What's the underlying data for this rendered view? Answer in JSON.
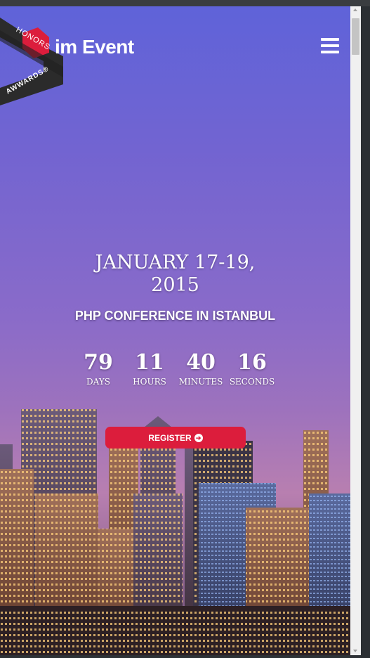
{
  "header": {
    "logo_text": "im Event",
    "menu_icon": "hamburger-menu-icon"
  },
  "badge": {
    "top_text": "HONORS",
    "bottom_text": "AWWARDS®"
  },
  "hero": {
    "date_line1": "JANUARY 17-19,",
    "date_line2": "2015",
    "subtitle": "PHP CONFERENCE IN ISTANBUL"
  },
  "countdown": [
    {
      "value": "79",
      "label": "DAYS"
    },
    {
      "value": "11",
      "label": "HOURS"
    },
    {
      "value": "40",
      "label": "MINUTES"
    },
    {
      "value": "16",
      "label": "SECONDS"
    }
  ],
  "register": {
    "label": "REGISTER",
    "icon": "arrow-circle-right-icon"
  },
  "colors": {
    "accent": "#dc1d3c"
  }
}
